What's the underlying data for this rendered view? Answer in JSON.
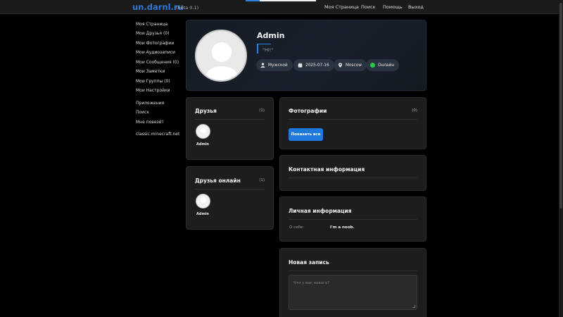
{
  "header": {
    "logo": "un.darnl.ru",
    "beta": "(beta 0.1)",
    "nav": [
      "Моя Страница",
      "Поиск",
      "Помощь",
      "Выход"
    ]
  },
  "sidebar": {
    "items": [
      "Моя Страница",
      "Мои Друзья (0)",
      "Мои Фотографии",
      "Мои Аудиозаписи",
      "Мои Сообщения (0)",
      "Мои Заметки",
      "Мои Группы (0)",
      "Мои Настройки",
      "Приложения",
      "Поиск",
      "Мне повезёт",
      "classic.minecraft.net"
    ]
  },
  "profile": {
    "name": "Admin",
    "status": "\"Hi!\"",
    "gender": "Мужской",
    "date": "2025-07-16",
    "city": "Moscow",
    "online": "Онлайн"
  },
  "friends": {
    "title": "Друзья",
    "count": "(1)",
    "items": [
      "Admin"
    ]
  },
  "friends_online": {
    "title": "Друзья онлайн",
    "count": "(1)",
    "items": [
      "Admin"
    ]
  },
  "photos": {
    "title": "Фотографии",
    "count": "(0)",
    "button": "Показать все"
  },
  "contact": {
    "title": "Контактная информация"
  },
  "personal": {
    "title": "Личная информация",
    "about_label": "О себе:",
    "about_value": "I'm a noob."
  },
  "new_post": {
    "title": "Новая запись",
    "placeholder": "Что у вас нового?"
  },
  "colors": {
    "accent": "#2f7fe0",
    "button": "#1f7ae0",
    "online": "#28c840",
    "bg": "#000000",
    "card": "#1d1d1d"
  },
  "icons": [
    "user-icon",
    "calendar-icon",
    "location-pin-icon",
    "online-dot-icon"
  ]
}
